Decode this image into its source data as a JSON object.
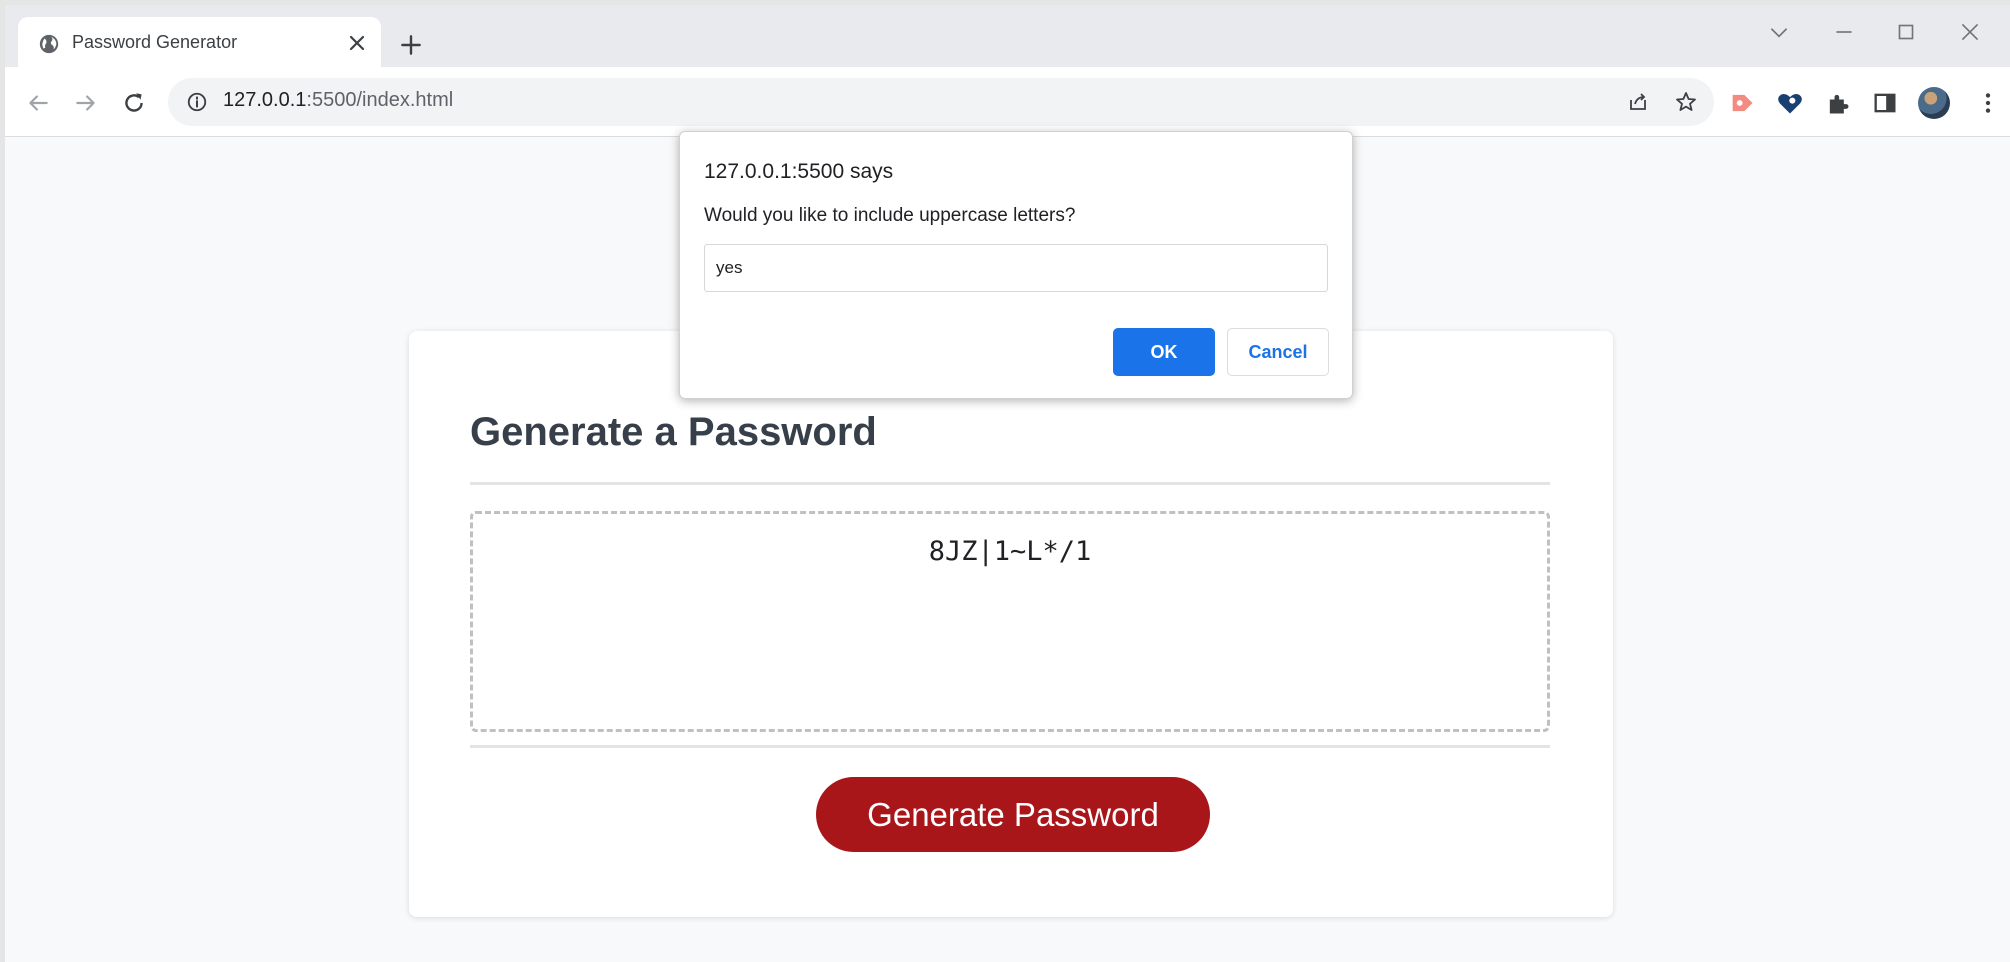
{
  "browser": {
    "tab": {
      "title": "Password Generator"
    },
    "url": {
      "host": "127.0.0.1",
      "rest": ":5500/index.html"
    }
  },
  "page": {
    "card_title": "Generate a Password",
    "password": "8JZ|1~L*/1",
    "generate_button": "Generate Password"
  },
  "dialog": {
    "title": "127.0.0.1:5500 says",
    "message": "Would you like to include uppercase letters?",
    "input_value": "yes",
    "ok_label": "OK",
    "cancel_label": "Cancel"
  },
  "colors": {
    "accent_blue": "#1a73e8",
    "generate_button": "#a8161a",
    "title_text": "#37404a"
  }
}
